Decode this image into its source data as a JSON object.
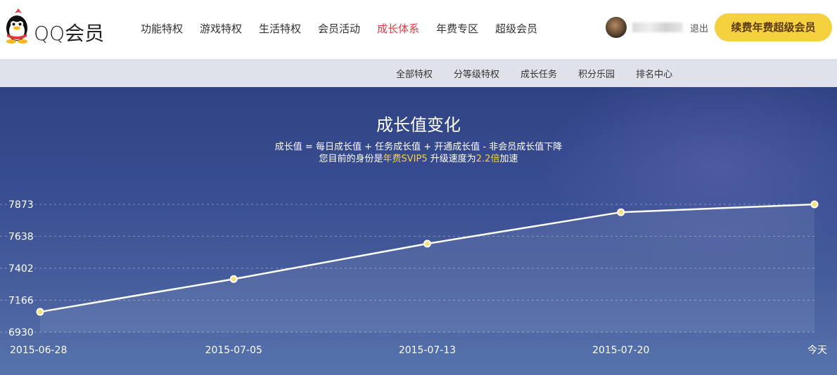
{
  "header": {
    "brand": "QQ会员",
    "nav": [
      {
        "label": "功能特权",
        "active": false
      },
      {
        "label": "游戏特权",
        "active": false
      },
      {
        "label": "生活特权",
        "active": false
      },
      {
        "label": "会员活动",
        "active": false
      },
      {
        "label": "成长体系",
        "active": true
      },
      {
        "label": "年费专区",
        "active": false
      },
      {
        "label": "超级会员",
        "active": false
      }
    ],
    "logout": "退出",
    "renew_button": "续费年费超级会员"
  },
  "subnav": [
    "全部特权",
    "分等级特权",
    "成长任务",
    "积分乐园",
    "排名中心"
  ],
  "hero": {
    "title": "成长值变化",
    "formula": "成长值 = 每日成长值 + 任务成长值 + 开通成长值 - 非会员成长值下降",
    "status_prefix": "您目前的身份是",
    "status_identity": "年费SVIP5",
    "status_middle": " 升级速度为",
    "status_speed": "2.2倍",
    "status_suffix": "加速"
  },
  "colors": {
    "accent_red": "#e0393e",
    "accent_yellow": "#f6d13f",
    "hero_top": "#2f4284",
    "hero_bottom": "#5774ad"
  },
  "chart_data": {
    "type": "line",
    "title": "",
    "xlabel": "",
    "ylabel": "",
    "x": [
      "2015-06-28",
      "2015-07-05",
      "2015-07-13",
      "2015-07-20",
      "今天"
    ],
    "series": [
      {
        "values": [
          7080,
          7322,
          7583,
          7815,
          7873
        ]
      }
    ],
    "yticks": [
      6930,
      7166,
      7402,
      7638,
      7873
    ],
    "ylim": [
      6930,
      7873
    ],
    "grid": true
  }
}
